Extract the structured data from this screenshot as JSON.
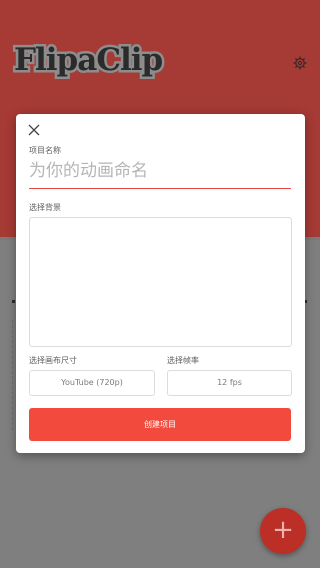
{
  "app": {
    "logo_text": "FlipaClip",
    "colors": {
      "header_red": "#a63a34",
      "accent": "#f24a3c",
      "underline": "#e2473f",
      "fab": "#bb2f27"
    }
  },
  "header": {
    "settings_icon": "gear-icon"
  },
  "dialog": {
    "close_icon": "close-icon",
    "project_name_label": "项目名称",
    "project_name_placeholder": "为你的动画命名",
    "background_label": "选择背景",
    "canvas_size_label": "选择画布尺寸",
    "canvas_size_value": "YouTube (720p)",
    "frame_rate_label": "选择帧率",
    "frame_rate_value": "12 fps",
    "create_button": "创建项目"
  },
  "fab": {
    "icon": "plus-icon",
    "symbol": "+"
  }
}
